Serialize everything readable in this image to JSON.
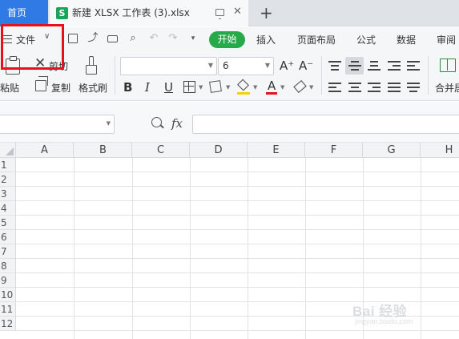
{
  "tabbar": {
    "home_tab": "首页",
    "doc_tab_title": "新建 XLSX 工作表 (3).xlsx",
    "doc_icon_letter": "S",
    "close_symbol": "✕",
    "new_tab_symbol": "+"
  },
  "menu": {
    "file_label": "文件",
    "file_chevron": "∨",
    "quick_access_icons": [
      "save-icon",
      "export-icon",
      "print-icon",
      "print-preview-icon",
      "undo-icon",
      "redo-icon",
      "more-dropdown-icon"
    ],
    "tabs": {
      "start": "开始",
      "insert": "插入",
      "page_layout": "页面布局",
      "formula": "公式",
      "data": "数据",
      "review": "审阅"
    },
    "active_tab_color": "#27a94a"
  },
  "ribbon": {
    "paste_label": "粘贴",
    "cut_label": "剪切",
    "copy_label": "复制",
    "format_painter_label": "格式刷",
    "font_name_value": "",
    "font_size_value": "6",
    "bold": "B",
    "italic": "I",
    "underline": "U",
    "font_color_letter": "A",
    "grow_font": "A⁺",
    "shrink_font": "A⁻",
    "merge_label": "合并居",
    "fill_color": "#f5d00f",
    "font_color": "#e0141f"
  },
  "formula_bar": {
    "name_box_value": "",
    "fx_label": "fx",
    "formula_value": ""
  },
  "grid": {
    "columns": [
      "A",
      "B",
      "C",
      "D",
      "E",
      "F",
      "G",
      "H"
    ],
    "rows": [
      "1",
      "2",
      "3",
      "4",
      "5",
      "6",
      "7",
      "8",
      "9",
      "10",
      "11",
      "12"
    ]
  },
  "highlight_color": "#e8101a",
  "watermark": {
    "text": "Bai 经验",
    "sub": "jingyan.baidu.com"
  }
}
